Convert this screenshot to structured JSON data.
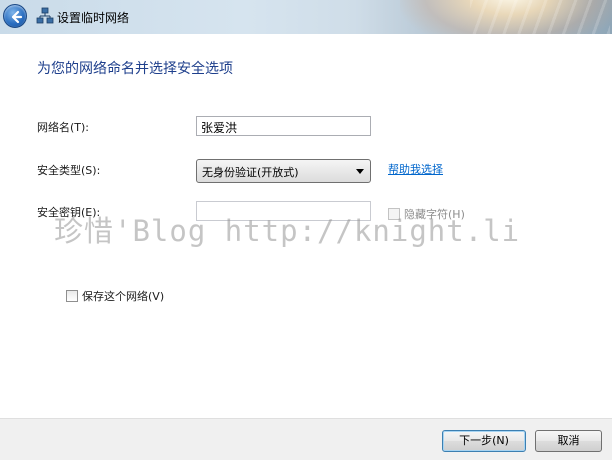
{
  "window": {
    "title": "设置临时网络"
  },
  "main": {
    "heading": "为您的网络命名并选择安全选项",
    "network_name_label": "网络名(T):",
    "network_name_value": "张爱洪",
    "security_type_label": "安全类型(S):",
    "security_type_value": "无身份验证(开放式)",
    "help_link": "帮助我选择",
    "security_key_label": "安全密钥(E):",
    "security_key_value": "",
    "hide_chars_label": "隐藏字符(H)",
    "save_network_label": "保存这个网络(V)"
  },
  "watermark": {
    "text": "珍惜'Blog http://knight.li"
  },
  "footer": {
    "next_label": "下一步(N)",
    "cancel_label": "取消"
  },
  "colors": {
    "heading": "#1e3f8c",
    "link": "#0066cc"
  }
}
